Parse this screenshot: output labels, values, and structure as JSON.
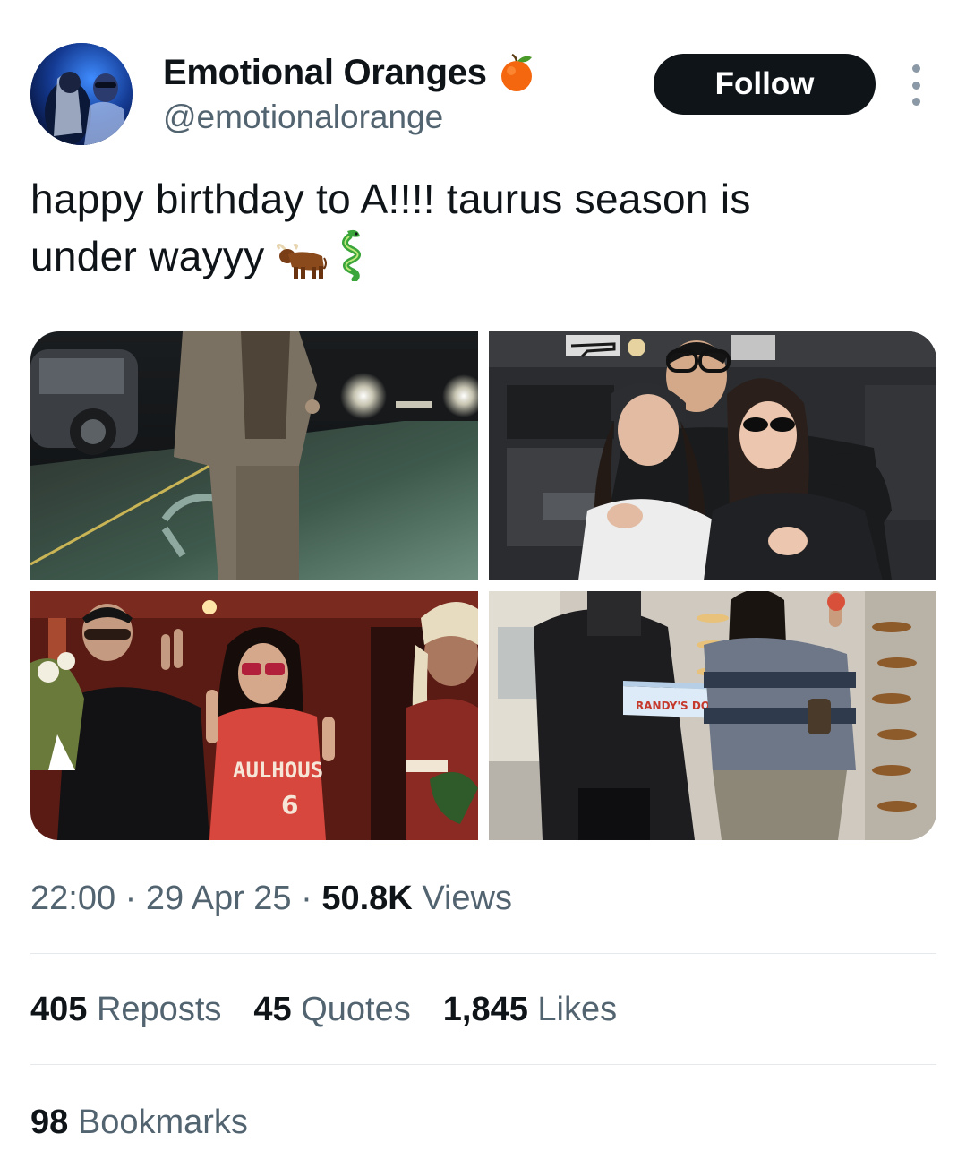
{
  "user": {
    "display_name": "Emotional Oranges",
    "handle": "@emotionalorange",
    "badge_icon": "orange-emoji-icon"
  },
  "actions": {
    "follow_label": "Follow",
    "more_icon": "more-vertical-icon"
  },
  "tweet": {
    "text_line1": "happy birthday to A!!!! taurus season is",
    "text_line2": "under wayyy",
    "emojis": [
      "ox-emoji-icon",
      "dragon-emoji-icon"
    ]
  },
  "media": {
    "photo2_text": "",
    "photo3_jersey_text": "AULHOUS",
    "photo3_jersey_number": "6",
    "photo4_box_text": "RANDY'S DONUTS"
  },
  "meta": {
    "time": "22:00",
    "date": "29 Apr 25",
    "views_count": "50.8K",
    "views_label": "Views",
    "dot": "·"
  },
  "stats": {
    "reposts_count": "405",
    "reposts_label": "Reposts",
    "quotes_count": "45",
    "quotes_label": "Quotes",
    "likes_count": "1,845",
    "likes_label": "Likes",
    "bookmarks_count": "98",
    "bookmarks_label": "Bookmarks"
  },
  "colors": {
    "text_primary": "#0f1419",
    "text_secondary": "#536471",
    "follow_bg": "#0f1419",
    "divider": "#e6e9ec"
  }
}
